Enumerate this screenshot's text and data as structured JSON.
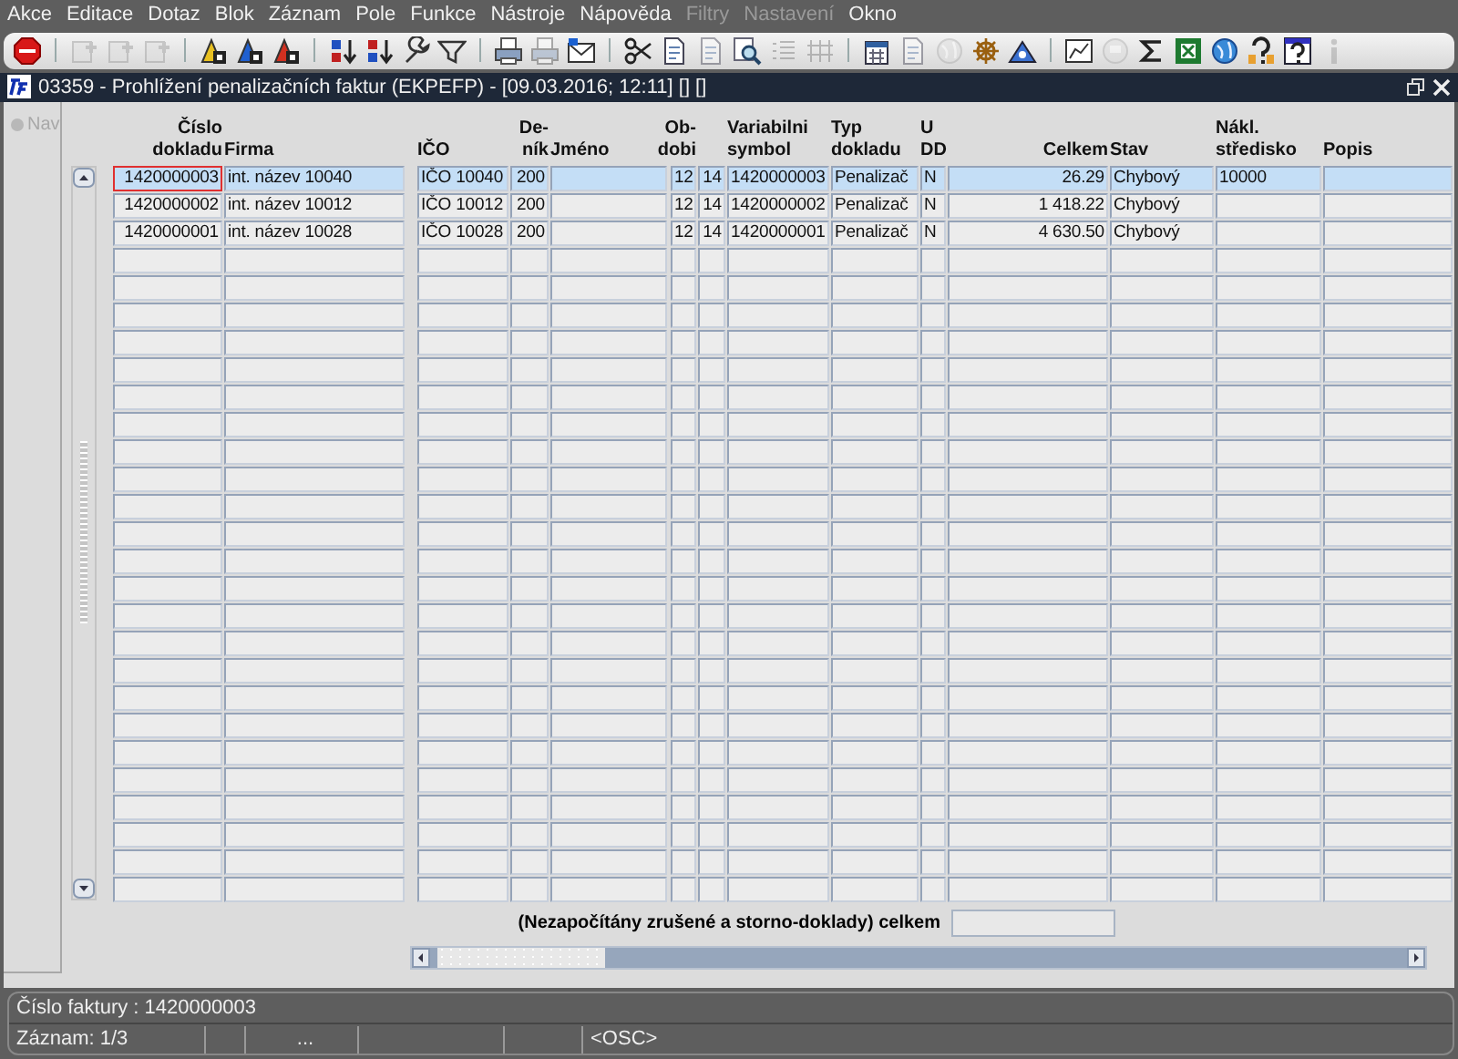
{
  "menu": [
    {
      "label": "Akce",
      "disabled": false
    },
    {
      "label": "Editace",
      "disabled": false
    },
    {
      "label": "Dotaz",
      "disabled": false
    },
    {
      "label": "Blok",
      "disabled": false
    },
    {
      "label": "Záznam",
      "disabled": false
    },
    {
      "label": "Pole",
      "disabled": false
    },
    {
      "label": "Funkce",
      "disabled": false
    },
    {
      "label": "Nástroje",
      "disabled": false
    },
    {
      "label": "Nápověda",
      "disabled": false
    },
    {
      "label": "Filtry",
      "disabled": true
    },
    {
      "label": "Nastavení",
      "disabled": true
    },
    {
      "label": "Okno",
      "disabled": false
    }
  ],
  "toolbar": [
    {
      "kind": "exit",
      "disabled": false
    },
    {
      "kind": "sep"
    },
    {
      "kind": "record-add",
      "disabled": true
    },
    {
      "kind": "record-copy",
      "disabled": true
    },
    {
      "kind": "record-delete",
      "disabled": true
    },
    {
      "kind": "sep"
    },
    {
      "kind": "query-enter",
      "disabled": false
    },
    {
      "kind": "query-run",
      "disabled": false
    },
    {
      "kind": "query-cancel",
      "disabled": false
    },
    {
      "kind": "sep"
    },
    {
      "kind": "sort-asc",
      "disabled": false
    },
    {
      "kind": "sort-desc",
      "disabled": false
    },
    {
      "kind": "wrench",
      "disabled": false
    },
    {
      "kind": "filter",
      "disabled": false
    },
    {
      "kind": "sep"
    },
    {
      "kind": "printer",
      "disabled": false
    },
    {
      "kind": "printer",
      "disabled": true
    },
    {
      "kind": "envelope",
      "disabled": false
    },
    {
      "kind": "sep"
    },
    {
      "kind": "scissors",
      "disabled": false
    },
    {
      "kind": "document",
      "disabled": false
    },
    {
      "kind": "document",
      "disabled": true
    },
    {
      "kind": "magnifier",
      "disabled": false
    },
    {
      "kind": "list",
      "disabled": true
    },
    {
      "kind": "columns",
      "disabled": true
    },
    {
      "kind": "sep"
    },
    {
      "kind": "calendar",
      "disabled": false
    },
    {
      "kind": "document",
      "disabled": true
    },
    {
      "kind": "globe",
      "disabled": true
    },
    {
      "kind": "wheel",
      "disabled": false
    },
    {
      "kind": "triangle",
      "disabled": false
    },
    {
      "kind": "sep"
    },
    {
      "kind": "chart",
      "disabled": false
    },
    {
      "kind": "disk",
      "disabled": true
    },
    {
      "kind": "sigma",
      "disabled": false
    },
    {
      "kind": "spreadsheet",
      "disabled": false
    },
    {
      "kind": "globe",
      "disabled": false
    },
    {
      "kind": "help",
      "disabled": false
    },
    {
      "kind": "help-box",
      "disabled": false
    },
    {
      "kind": "info",
      "disabled": true
    }
  ],
  "window": {
    "title": "03359 - Prohlížení penalizačních faktur (EKPEFP) - [09.03.2016; 12:11] [] []"
  },
  "nav": {
    "label": "Nav",
    "disabled": true
  },
  "table": {
    "columns": {
      "cislo_dokladu": "Číslo\ndokladu",
      "firma": "Firma",
      "ico": "IČO",
      "denik": "De-\nník",
      "jmeno": "Jméno",
      "obdobi": "Ob-\ndobi",
      "variabilni_symbol": "Variabilni\nsymbol",
      "typ_dokladu": "Typ\ndokladu",
      "u_dd": "U\nDD",
      "celkem": "Celkem",
      "stav": "Stav",
      "nakl_stredisko": "Nákl.\nstředisko",
      "popis": "Popis"
    },
    "rows": [
      {
        "selected": true,
        "focused": true,
        "cislo_dokladu": "1420000003",
        "firma": "int. název 10040",
        "ico": "IČO 10040",
        "denik": "200",
        "obdobi": "12",
        "column_7": "14",
        "variabilni_symbol": "1420000003",
        "typ_dokladu": "Penalizač",
        "u_dd": "N",
        "celkem": "26.29",
        "stav": "Chybový",
        "nakl_stredisko": "10000"
      },
      {
        "selected": false,
        "focused": false,
        "cislo_dokladu": "1420000002",
        "firma": "int. název 10012",
        "ico": "IČO 10012",
        "denik": "200",
        "obdobi": "12",
        "column_7": "14",
        "variabilni_symbol": "1420000002",
        "typ_dokladu": "Penalizač",
        "u_dd": "N",
        "celkem": "1 418.22",
        "stav": "Chybový"
      },
      {
        "selected": false,
        "focused": false,
        "cislo_dokladu": "1420000001",
        "firma": "int. název 10028",
        "ico": "IČO 10028",
        "denik": "200",
        "obdobi": "12",
        "column_7": "14",
        "variabilni_symbol": "1420000001",
        "typ_dokladu": "Penalizač",
        "u_dd": "N",
        "celkem": "4 630.50",
        "stav": "Chybový"
      }
    ],
    "total_label": "(Nezapočítány zrušené a storno-doklady) celkem"
  },
  "status_bar": {
    "message": "Číslo faktury : 1420000003",
    "record": "Záznam: 1/3",
    "ellipsis": "...",
    "mode": "<OSC>"
  }
}
